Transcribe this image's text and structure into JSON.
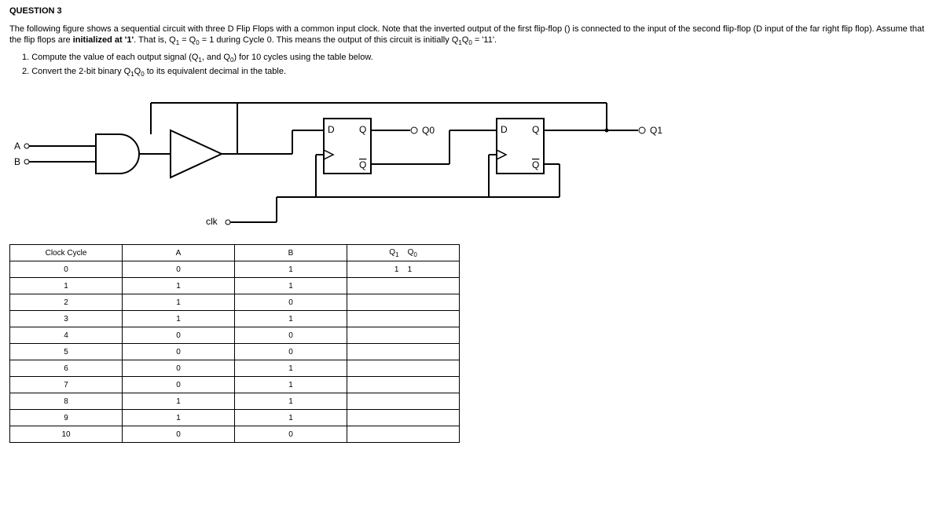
{
  "title": "QUESTION 3",
  "desc_part1": "The following figure shows a sequential circuit with three D Flip Flops with a common input clock. Note that the inverted output of the first flip-flop () is connected to the input of the second flip-flop (D input of the far right flip flop). Assume that the flip flops are ",
  "desc_bold": "initialized at '1'",
  "desc_part2": ". That is, Q",
  "desc_part3": " = Q",
  "desc_part4": " = 1 during Cycle 0. This means the output of this circuit is initially Q",
  "desc_part5": "Q",
  "desc_part6": " = '11'.",
  "item1_a": "1. Compute the value of each output signal (Q",
  "item1_b": ", and Q",
  "item1_c": ") for 10 cycles using the table below.",
  "item2_a": "2. Convert the 2-bit binary Q",
  "item2_b": "Q",
  "item2_c": " to its equivalent decimal in the table.",
  "circuit": {
    "A": "A",
    "B": "B",
    "clk": "clk",
    "D": "D",
    "Q": "Q",
    "Q0": "Q0",
    "Q1": "Q1",
    "Qbar": "Q"
  },
  "table": {
    "header": {
      "cycle": "Clock Cycle",
      "A": "A",
      "B": "B",
      "Q1": "Q",
      "Q0": "Q"
    },
    "rows": [
      {
        "cycle": "0",
        "A": "0",
        "B": "1",
        "Q1": "1",
        "Q0": "1"
      },
      {
        "cycle": "1",
        "A": "1",
        "B": "1",
        "Q1": "",
        "Q0": ""
      },
      {
        "cycle": "2",
        "A": "1",
        "B": "0",
        "Q1": "",
        "Q0": ""
      },
      {
        "cycle": "3",
        "A": "1",
        "B": "1",
        "Q1": "",
        "Q0": ""
      },
      {
        "cycle": "4",
        "A": "0",
        "B": "0",
        "Q1": "",
        "Q0": ""
      },
      {
        "cycle": "5",
        "A": "0",
        "B": "0",
        "Q1": "",
        "Q0": ""
      },
      {
        "cycle": "6",
        "A": "0",
        "B": "1",
        "Q1": "",
        "Q0": ""
      },
      {
        "cycle": "7",
        "A": "0",
        "B": "1",
        "Q1": "",
        "Q0": ""
      },
      {
        "cycle": "8",
        "A": "1",
        "B": "1",
        "Q1": "",
        "Q0": ""
      },
      {
        "cycle": "9",
        "A": "1",
        "B": "1",
        "Q1": "",
        "Q0": ""
      },
      {
        "cycle": "10",
        "A": "0",
        "B": "0",
        "Q1": "",
        "Q0": ""
      }
    ]
  }
}
